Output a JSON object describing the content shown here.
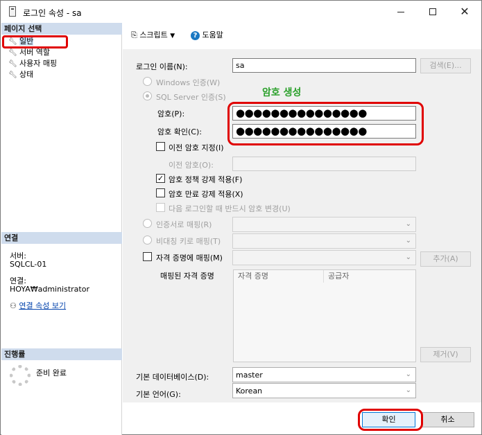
{
  "window": {
    "title": "로그인 속성 - sa",
    "controls": {
      "minimize": "—",
      "maximize": "☐",
      "close": "✕"
    }
  },
  "left": {
    "page_select_header": "페이지 선택",
    "nav": [
      {
        "label": "일반",
        "icon": "wrench-icon"
      },
      {
        "label": "서버 역할",
        "icon": "wrench-icon"
      },
      {
        "label": "사용자 매핑",
        "icon": "wrench-icon"
      },
      {
        "label": "상태",
        "icon": "wrench-icon"
      }
    ],
    "connection_header": "연결",
    "server_label": "서버:",
    "server_value": "SQLCL-01",
    "connection_label": "연결:",
    "connection_value": "HOYA₩administrator",
    "view_connection_link": "연결 속성 보기",
    "progress_header": "진행률",
    "progress_status": "준비 완료"
  },
  "toolbar": {
    "script_label": "스크립트",
    "help_label": "도움말"
  },
  "form": {
    "login_name_label": "로그인 이름(N):",
    "login_name_value": "sa",
    "search_button": "검색(E)...",
    "windows_auth": "Windows 인증(W)",
    "sql_auth": "SQL Server 인증(S)",
    "password_label": "암호(P):",
    "password_value": "●●●●●●●●●●●●●●●",
    "confirm_label": "암호 확인(C):",
    "confirm_value": "●●●●●●●●●●●●●●●",
    "old_password_check": "이전 암호 지정(I)",
    "old_password_label": "이전 암호(O):",
    "enforce_policy": "암호 정책 강제 적용(F)",
    "enforce_expiration": "암호 만료 강제 적용(X)",
    "must_change": "다음 로그인할 때 반드시 암호 변경(U)",
    "cert_mapping": "인증서로 매핑(R)",
    "asym_key_mapping": "비대칭 키로 매핑(T)",
    "credential_mapping": "자격 증명에 매핑(M)",
    "add_button": "추가(A)",
    "mapped_credentials_label": "매핑된 자격 증명",
    "grid_columns": [
      "자격 증명",
      "공급자"
    ],
    "remove_button": "제거(V)",
    "default_db_label": "기본 데이터베이스(D):",
    "default_db_value": "master",
    "default_lang_label": "기본 언어(G):",
    "default_lang_value": "Korean"
  },
  "annotation": {
    "text": "암호 생성",
    "color": "#e00000",
    "text_color": "#2ba02b"
  },
  "footer": {
    "ok_button": "확인",
    "cancel_button": "취소"
  }
}
